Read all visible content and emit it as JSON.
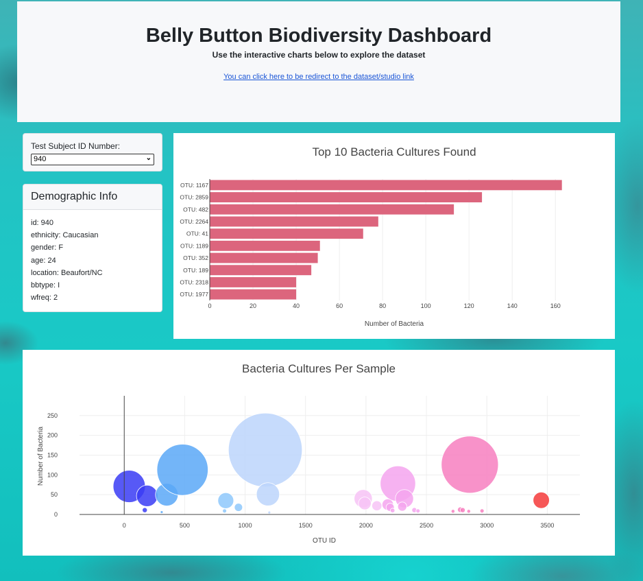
{
  "header": {
    "title": "Belly Button Biodiversity Dashboard",
    "subtitle": "Use the interactive charts below to explore the dataset",
    "link_text": "You can click here to be redirect to the dataset/studio link"
  },
  "selector": {
    "label": "Test Subject ID Number:",
    "selected": "940"
  },
  "demographics": {
    "title": "Demographic Info",
    "rows": [
      "id: 940",
      "ethnicity: Caucasian",
      "gender: F",
      "age: 24",
      "location: Beaufort/NC",
      "bbtype: I",
      "wfreq: 2"
    ]
  },
  "colors": {
    "bar": "#dc657d",
    "page_accent": "#19c9c6"
  },
  "chart_data": [
    {
      "type": "bar",
      "orientation": "horizontal",
      "title": "Top 10 Bacteria Cultures Found",
      "xlabel": "Number of Bacteria",
      "ylabel": "",
      "xlim": [
        0,
        165
      ],
      "xticks": [
        0,
        20,
        40,
        60,
        80,
        100,
        120,
        140,
        160
      ],
      "categories": [
        "OTU: 1167",
        "OTU: 2859",
        "OTU: 482",
        "OTU: 2264",
        "OTU: 41",
        "OTU: 1189",
        "OTU: 352",
        "OTU: 189",
        "OTU: 2318",
        "OTU: 1977"
      ],
      "values": [
        163,
        126,
        113,
        78,
        71,
        51,
        50,
        47,
        40,
        40
      ],
      "grid": true
    },
    {
      "type": "scatter",
      "title": "Bacteria Cultures Per Sample",
      "xlabel": "OTU ID",
      "ylabel": "Number of Bacteria",
      "xlim": [
        -370,
        3770
      ],
      "ylim": [
        0,
        300
      ],
      "xticks": [
        0,
        500,
        1000,
        1500,
        2000,
        2500,
        3000,
        3500
      ],
      "yticks": [
        0,
        50,
        100,
        150,
        200,
        250
      ],
      "grid": true,
      "points": [
        {
          "x": 41,
          "y": 71,
          "size": 71
        },
        {
          "x": 189,
          "y": 47,
          "size": 47
        },
        {
          "x": 352,
          "y": 50,
          "size": 50
        },
        {
          "x": 482,
          "y": 113,
          "size": 113
        },
        {
          "x": 170,
          "y": 11,
          "size": 11
        },
        {
          "x": 310,
          "y": 6,
          "size": 6
        },
        {
          "x": 840,
          "y": 35,
          "size": 35
        },
        {
          "x": 945,
          "y": 18,
          "size": 18
        },
        {
          "x": 830,
          "y": 9,
          "size": 9
        },
        {
          "x": 1167,
          "y": 163,
          "size": 163
        },
        {
          "x": 1189,
          "y": 51,
          "size": 51
        },
        {
          "x": 1200,
          "y": 5,
          "size": 5
        },
        {
          "x": 1977,
          "y": 40,
          "size": 40
        },
        {
          "x": 1990,
          "y": 28,
          "size": 28
        },
        {
          "x": 2090,
          "y": 22,
          "size": 22
        },
        {
          "x": 2180,
          "y": 25,
          "size": 25
        },
        {
          "x": 2200,
          "y": 18,
          "size": 18
        },
        {
          "x": 2264,
          "y": 78,
          "size": 78
        },
        {
          "x": 2318,
          "y": 40,
          "size": 40
        },
        {
          "x": 2300,
          "y": 20,
          "size": 20
        },
        {
          "x": 2220,
          "y": 10,
          "size": 10
        },
        {
          "x": 2400,
          "y": 11,
          "size": 11
        },
        {
          "x": 2430,
          "y": 9,
          "size": 9
        },
        {
          "x": 2720,
          "y": 8,
          "size": 8
        },
        {
          "x": 2780,
          "y": 12,
          "size": 12
        },
        {
          "x": 2800,
          "y": 11,
          "size": 11
        },
        {
          "x": 2850,
          "y": 8,
          "size": 8
        },
        {
          "x": 2859,
          "y": 126,
          "size": 126
        },
        {
          "x": 2960,
          "y": 9,
          "size": 9
        },
        {
          "x": 3450,
          "y": 36,
          "size": 36
        }
      ]
    }
  ]
}
